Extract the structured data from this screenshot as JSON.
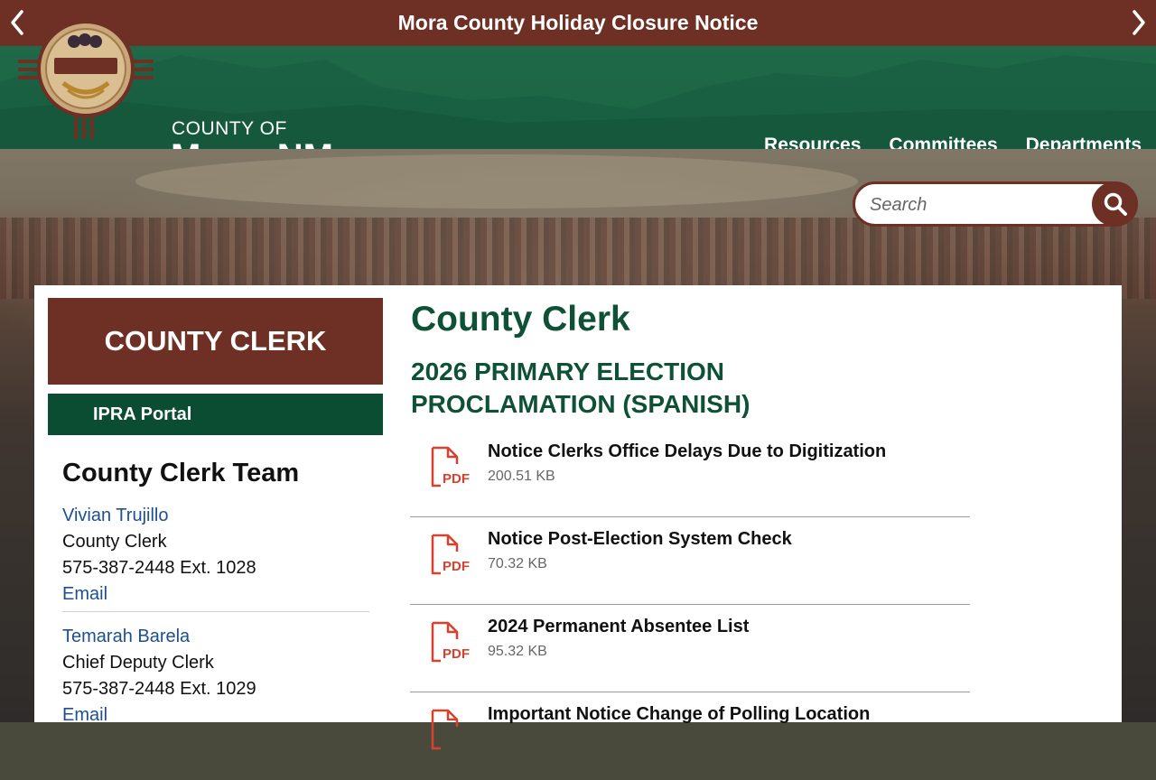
{
  "alert": {
    "title": "Mora County Holiday Closure Notice"
  },
  "header": {
    "county_of": "COUNTY OF",
    "county_name": "Mora, NM",
    "nav": [
      "Resources",
      "Committees",
      "Departments"
    ]
  },
  "search": {
    "placeholder": "Search"
  },
  "sidebar": {
    "title": "COUNTY CLERK",
    "link": "IPRA Portal",
    "team_title": "County Clerk Team",
    "people": [
      {
        "name": "Vivian Trujillo",
        "role": "County Clerk",
        "phone": "575-387-2448 Ext. 1028",
        "email": "Email"
      },
      {
        "name": "Temarah Barela",
        "role": "Chief Deputy Clerk",
        "phone": "575-387-2448 Ext. 1029",
        "email": "Email"
      }
    ]
  },
  "main": {
    "title": "County Clerk",
    "subtitle": "2026 PRIMARY ELECTION PROCLAMATION (SPANISH)",
    "documents": [
      {
        "title": "Notice Clerks Office Delays Due to Digitization",
        "size": "200.51 KB"
      },
      {
        "title": "Notice Post-Election System Check",
        "size": "70.32 KB"
      },
      {
        "title": "2024 Permanent Absentee List",
        "size": "95.32 KB"
      },
      {
        "title": "Important Notice Change of Polling Location",
        "size": ""
      }
    ],
    "pdf_label": "PDF"
  },
  "colors": {
    "brown": "#6e3024",
    "green": "#0b4d33",
    "header_green": "#1f6848",
    "link_blue": "#1d4f91",
    "pdf_red": "#d9412f"
  }
}
